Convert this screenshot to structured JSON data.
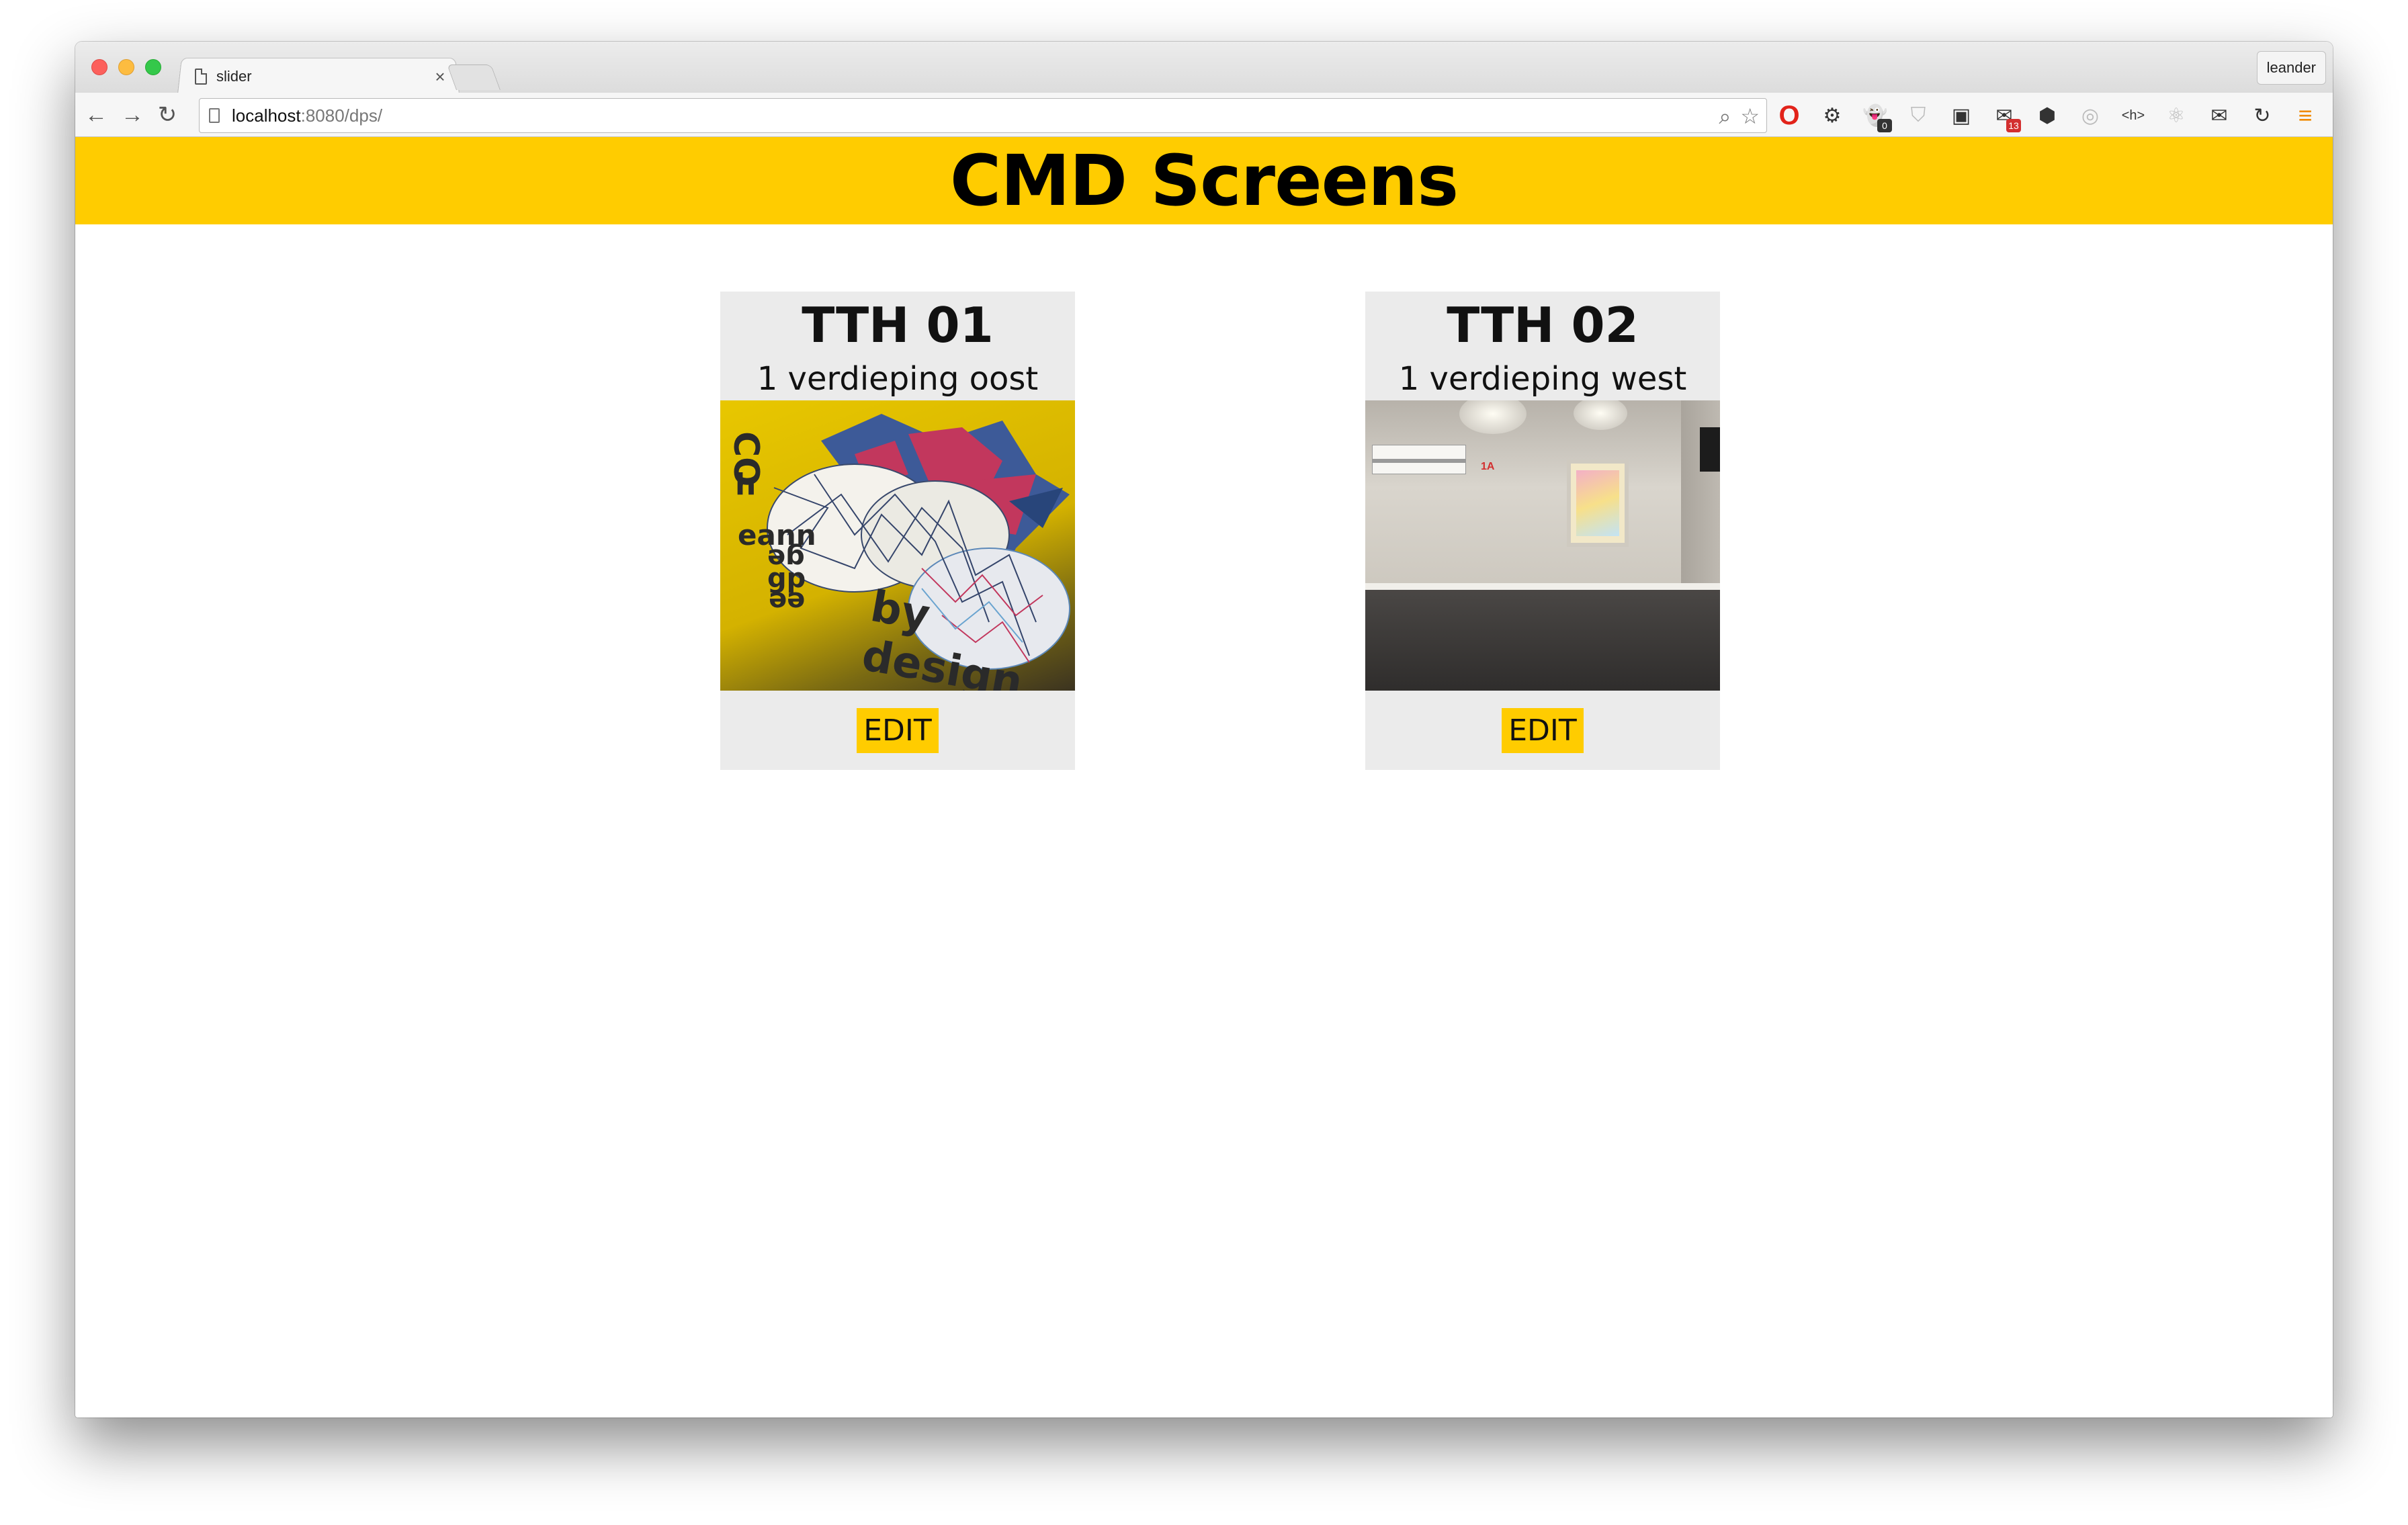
{
  "browser": {
    "tab_title": "slider",
    "tab_close": "×",
    "profile_name": "leander",
    "url_host": "localhost",
    "url_path": ":8080/dps/",
    "extensions": [
      {
        "name": "opera-icon",
        "glyph": "O"
      },
      {
        "name": "gear-icon",
        "glyph": "⚙"
      },
      {
        "name": "ghost-icon",
        "glyph": "👻",
        "badge": "0"
      },
      {
        "name": "shield-outline-icon",
        "glyph": "⛉"
      },
      {
        "name": "ninja-icon",
        "glyph": "▣"
      },
      {
        "name": "mail-check-icon",
        "glyph": "✉",
        "badge": "13"
      },
      {
        "name": "ublock-icon",
        "glyph": "⬢"
      },
      {
        "name": "noscript-icon",
        "glyph": "◎"
      },
      {
        "name": "html-icon",
        "glyph": "<h>"
      },
      {
        "name": "react-icon",
        "glyph": "⚛"
      },
      {
        "name": "envelope-icon",
        "glyph": "✉"
      },
      {
        "name": "sync-icon",
        "glyph": "↻"
      },
      {
        "name": "menu-icon",
        "glyph": "≡"
      }
    ]
  },
  "header": {
    "title": "CMD Screens"
  },
  "screens": [
    {
      "name": "TTH 01",
      "location": "1 verdieping oost",
      "edit_label": "EDIT",
      "photo": "yellow-graffiti-wall"
    },
    {
      "name": "TTH 02",
      "location": "1 verdieping west",
      "edit_label": "EDIT",
      "photo": "hallway-with-poster"
    }
  ],
  "photo1_text": {
    "line1": "CO",
    "line2": "h",
    "line3": "eann",
    "line4": "ge",
    "line5": "gp",
    "line6": "ee",
    "tagline": "by design"
  },
  "photo2_text": {
    "room_label": "1A"
  },
  "colors": {
    "accent": "#ffcc00",
    "card_bg": "#ebebeb"
  }
}
